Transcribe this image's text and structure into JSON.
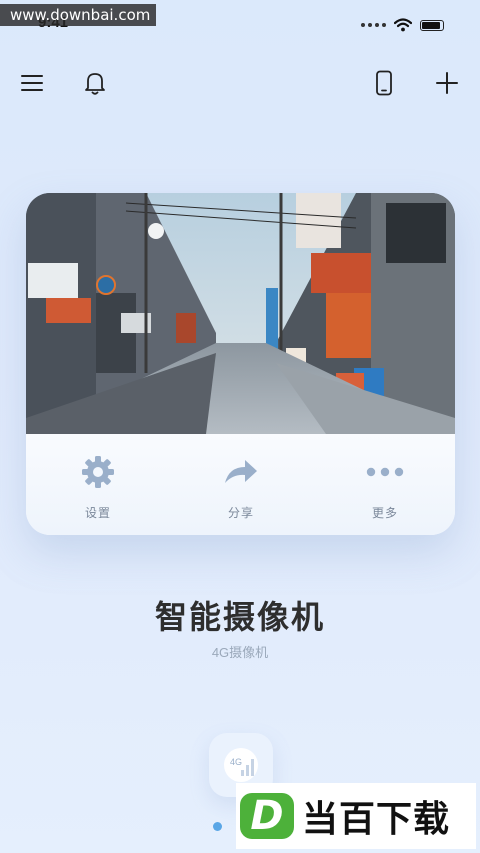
{
  "watermark_top": "www.downbai.com",
  "status_bar": {
    "time": "9:41"
  },
  "card": {
    "actions": [
      {
        "label": "设置",
        "icon": "gear-icon"
      },
      {
        "label": "分享",
        "icon": "share-arrow-icon"
      },
      {
        "label": "更多",
        "icon": "more-dots-icon"
      }
    ]
  },
  "device": {
    "title": "智能摄像机",
    "subtitle": "4G摄像机"
  },
  "bottom_icon_label": "4G",
  "watermark_logo": {
    "badge": "D",
    "brand": "当百下载"
  },
  "colors": {
    "background": "#dbe9fb",
    "accent": "#5aa6e6",
    "icon_muted": "#9aafca",
    "logo_green": "#4db13a"
  }
}
